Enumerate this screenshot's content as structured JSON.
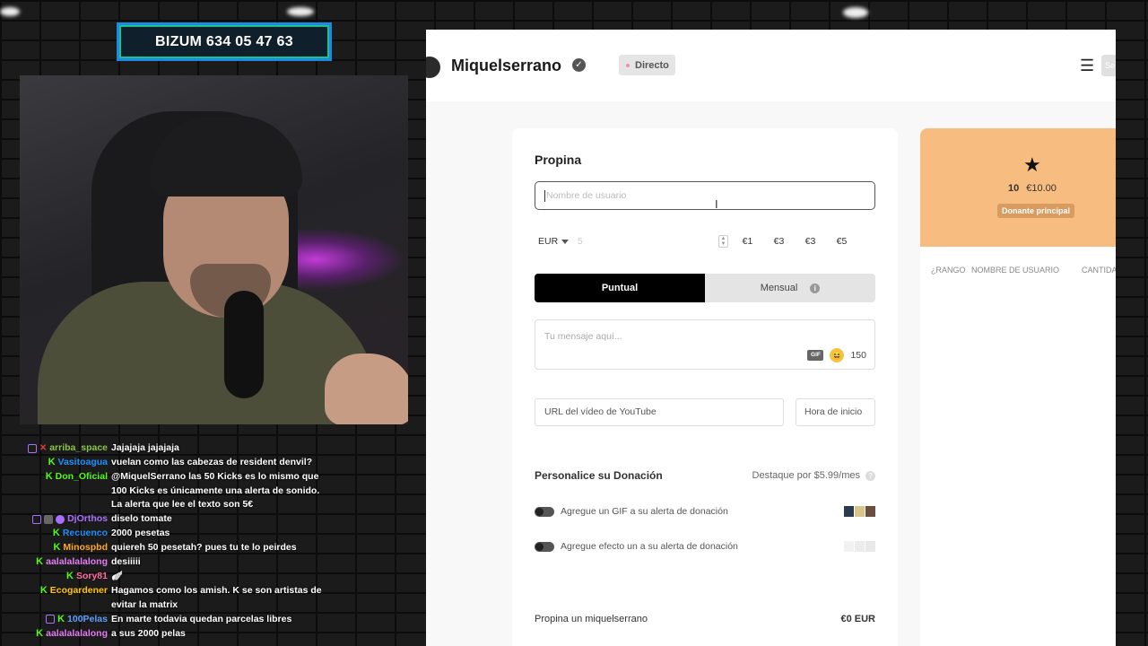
{
  "overlay": {
    "bizum_banner": "BIZUM 634 05 47 63"
  },
  "chat": [
    {
      "user": "arriba_space",
      "color": "#8bc34a",
      "badges": [
        "twitch",
        "x"
      ],
      "text": "Jajajaja jajajaja"
    },
    {
      "user": "Vasitoagua",
      "color": "#1e90ff",
      "badges": [
        "kick"
      ],
      "text": "vuelan como las cabezas de resident denvil?"
    },
    {
      "user": "Don_Oficial",
      "color": "#53fc18",
      "badges": [
        "kick"
      ],
      "text": "@MiquelSerrano las 50 Kicks es lo mismo que 100 Kicks es únicamente una alerta de sonido. La alerta que lee el texto son 5€"
    },
    {
      "user": "DjOrthos",
      "color": "#a970ff",
      "badges": [
        "twitch",
        "mod",
        "sub"
      ],
      "text": "diselo tomate"
    },
    {
      "user": "Recuenco",
      "color": "#1e90ff",
      "badges": [
        "kick"
      ],
      "text": "2000 pesetas"
    },
    {
      "user": "Minospbd",
      "color": "#ffa726",
      "badges": [
        "kick"
      ],
      "text": "quiereh 50 pesetah? pues tu te lo peirdes"
    },
    {
      "user": "aalalalalalong",
      "color": "#e57cf5",
      "badges": [
        "kick"
      ],
      "text": "desiiiii"
    },
    {
      "user": "Sory81",
      "color": "#ff6b9d",
      "badges": [
        "kick"
      ],
      "text": "🪽"
    },
    {
      "user": "Ecogardener",
      "color": "#ffc107",
      "badges": [
        "kick"
      ],
      "text": "Hagamos como los amish. K se son artistas de evitar la matrix"
    },
    {
      "user": "100Pelas",
      "color": "#5c9eff",
      "badges": [
        "twitch",
        "kick"
      ],
      "text": "En marte todavia quedan parcelas libres"
    },
    {
      "user": "aalalalalalong",
      "color": "#e57cf5",
      "badges": [
        "kick"
      ],
      "text": "a sus 2000 pelas"
    }
  ],
  "header": {
    "streamer": "Miquelserrano",
    "verified_icon": "check-circle",
    "live_label": "Directo",
    "side_button": "Se"
  },
  "donation_form": {
    "title": "Propina",
    "username_placeholder": "Nombre de usuario",
    "currency": "EUR",
    "amount_placeholder": "5",
    "presets": [
      "€1",
      "€3",
      "€3",
      "€5"
    ],
    "frequency": {
      "one_time": "Puntual",
      "monthly": "Mensual"
    },
    "message_placeholder": "Tu mensaje aquí...",
    "gif_label": "GIF",
    "char_count": "150",
    "youtube_placeholder": "URL del vídeo de YouTube",
    "start_time_placeholder": "Hora de inicio",
    "personalize_title": "Personalice su Donación",
    "highlight_price": "Destaque por $5.99/mes",
    "option_gif": "Agregue un GIF a su alerta de donación",
    "option_effect": "Agregue efecto un a su alerta de donación",
    "tip_label": "Propina un miquelserrano",
    "tip_amount": "€0 EUR"
  },
  "top_donor": {
    "rank_icon": "star-1",
    "count": "10",
    "amount": "€10.00",
    "label": "Donante principal",
    "columns": [
      "¿RANGO",
      "NOMBRE DE USUARIO",
      "CANTIDA"
    ]
  },
  "colors": {
    "accent_dark": "#000000",
    "donor_bg": "#f7bd80",
    "kick_green": "#53fc18",
    "bizum_border": "#1e88e5"
  }
}
